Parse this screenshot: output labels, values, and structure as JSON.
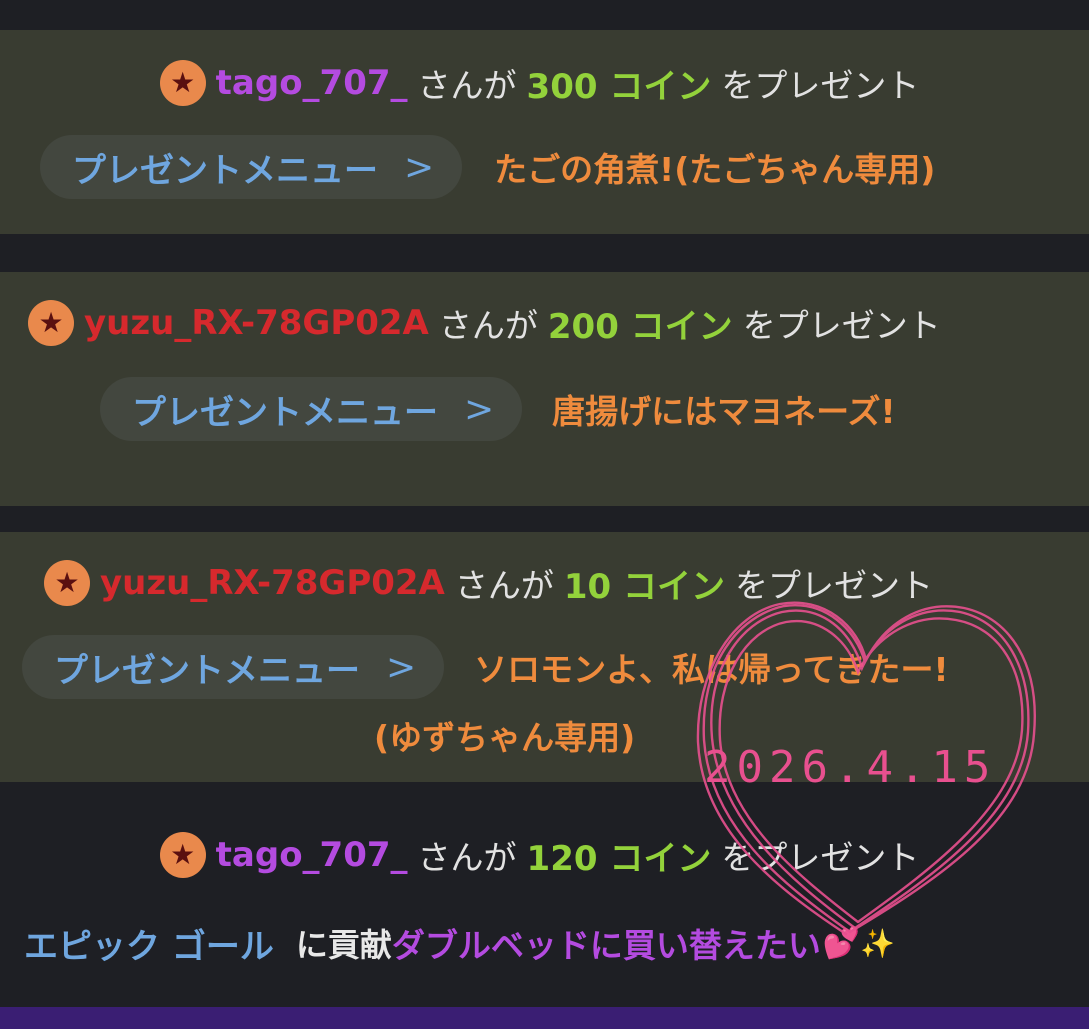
{
  "gifts": [
    {
      "star_icon": "star-icon",
      "user": "tago_707_",
      "user_color": "#b44be0",
      "san_ga": "さんが",
      "coins": "300 コイン",
      "present": "をプレゼント",
      "menu_label": "プレゼントメニュー",
      "chevron_icon": "chevron-right-icon",
      "message": "たごの角煮!(たごちゃん専用)"
    },
    {
      "star_icon": "star-icon",
      "user": "yuzu_RX-78GP02A",
      "user_color": "#d6292d",
      "san_ga": "さんが",
      "coins": "200 コイン",
      "present": "をプレゼント",
      "menu_label": "プレゼントメニュー",
      "chevron_icon": "chevron-right-icon",
      "message": "唐揚げにはマヨネーズ!"
    },
    {
      "star_icon": "star-icon",
      "user": "yuzu_RX-78GP02A",
      "user_color": "#d6292d",
      "san_ga": "さんが",
      "coins": "10 コイン",
      "present": "をプレゼント",
      "menu_label": "プレゼントメニュー",
      "chevron_icon": "chevron-right-icon",
      "message_line1": "ソロモンよ、私は帰ってきたー!",
      "message_line2": "(ゆずちゃん専用)"
    },
    {
      "star_icon": "star-icon",
      "user": "tago_707_",
      "user_color": "#b44be0",
      "san_ga": "さんが",
      "coins": "120 コイン",
      "present": "をプレゼント",
      "goal_label": "エピック ゴール",
      "contribute": "に貢献",
      "goal_name": "ダブルベッドに買い替えたい",
      "emoji_heart": "💕",
      "emoji_sparkle": "✨"
    }
  ],
  "overlay": {
    "date": "2026.4.15",
    "heart_icon": "hand-drawn-heart-icon",
    "heart_color": "#e8508f"
  }
}
